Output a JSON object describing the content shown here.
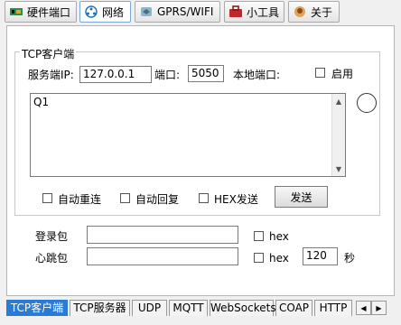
{
  "top_tabs": [
    {
      "label": "硬件端口",
      "icon": "board-icon"
    },
    {
      "label": "网络",
      "icon": "network-icon"
    },
    {
      "label": "GPRS/WIFI",
      "icon": "gprs-wifi-icon"
    },
    {
      "label": "小工具",
      "icon": "toolbox-icon"
    },
    {
      "label": "关于",
      "icon": "about-icon"
    }
  ],
  "group": {
    "title": "TCP客户端",
    "server_ip_label": "服务端IP:",
    "server_ip_value": "127.0.0.1",
    "port_label": "端口:",
    "port_value": "5050",
    "local_port_label": "本地端口:",
    "enable_label": "启用",
    "message_text": "Q1",
    "auto_reconnect_label": "自动重连",
    "auto_reply_label": "自动回复",
    "hex_send_label": "HEX发送",
    "send_button": "发送"
  },
  "login_label": "登录包",
  "heartbeat_label": "心跳包",
  "hex_label": "hex",
  "heartbeat_interval": "120",
  "seconds_label": "秒",
  "bottom_tabs": [
    "TCP客户端",
    "TCP服务器",
    "UDP",
    "MQTT",
    "WebSockets",
    "COAP",
    "HTTP"
  ],
  "nav": {
    "left": "◀",
    "right": "▶"
  }
}
